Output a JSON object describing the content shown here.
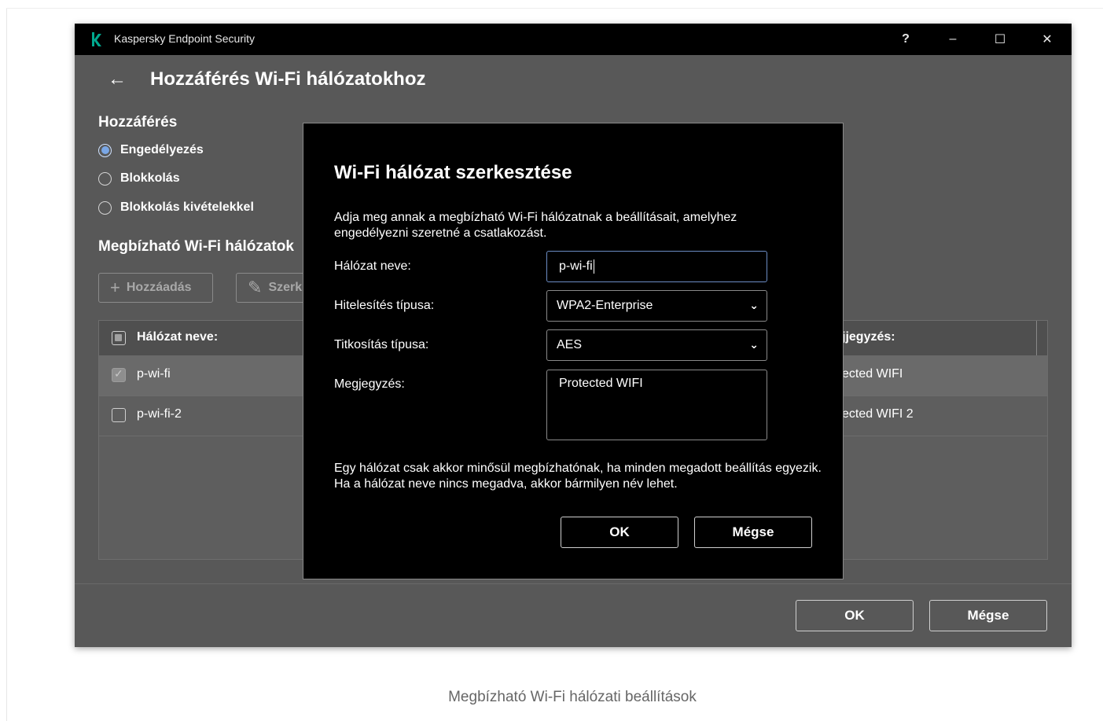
{
  "window": {
    "app_title": "Kaspersky Endpoint Security",
    "help_label": "?",
    "minimize_label": "–",
    "maximize_label": "☐",
    "close_label": "✕"
  },
  "page": {
    "back_label": "←",
    "title": "Hozzáférés Wi-Fi hálózatokhoz"
  },
  "access": {
    "title": "Hozzáférés",
    "options": [
      {
        "label": "Engedélyezés",
        "selected": true
      },
      {
        "label": "Blokkolás",
        "selected": false
      },
      {
        "label": "Blokkolás kivételekkel",
        "selected": false
      }
    ]
  },
  "trusted": {
    "title": "Megbízható Wi-Fi hálózatok",
    "add_label": "Hozzáadás",
    "edit_label": "Szerk",
    "table": {
      "col_name": "Hálózat neve:",
      "col_note": "jjegyzés:",
      "rows": [
        {
          "name": "p-wi-fi",
          "note": "ected WIFI",
          "checked": true
        },
        {
          "name": "p-wi-fi-2",
          "note": "ected WIFI 2",
          "checked": false
        }
      ]
    }
  },
  "footer": {
    "ok_label": "OK",
    "cancel_label": "Mégse"
  },
  "dialog": {
    "title": "Wi-Fi hálózat szerkesztése",
    "description": "Adja meg annak a megbízható Wi-Fi hálózatnak a beállításait, amelyhez engedélyezni szeretné a csatlakozást.",
    "network_name_label": "Hálózat neve:",
    "network_name_value": "p-wi-fi",
    "auth_label": "Hitelesítés típusa:",
    "auth_value": "WPA2-Enterprise",
    "encryption_label": "Titkosítás típusa:",
    "encryption_value": "AES",
    "comment_label": "Megjegyzés:",
    "comment_value": "Protected WIFI",
    "note": "Egy hálózat csak akkor minősül megbízhatónak, ha minden megadott beállítás egyezik. Ha a hálózat neve nincs megadva, akkor bármilyen név lehet.",
    "ok_label": "OK",
    "cancel_label": "Mégse"
  },
  "caption": "Megbízható Wi-Fi hálózati beállítások",
  "colors": {
    "window_bg": "#585858",
    "titlebar": "#000000",
    "dialog_bg": "#000000",
    "focus_border": "#6b8cc4",
    "logo_green": "#00a88e"
  }
}
